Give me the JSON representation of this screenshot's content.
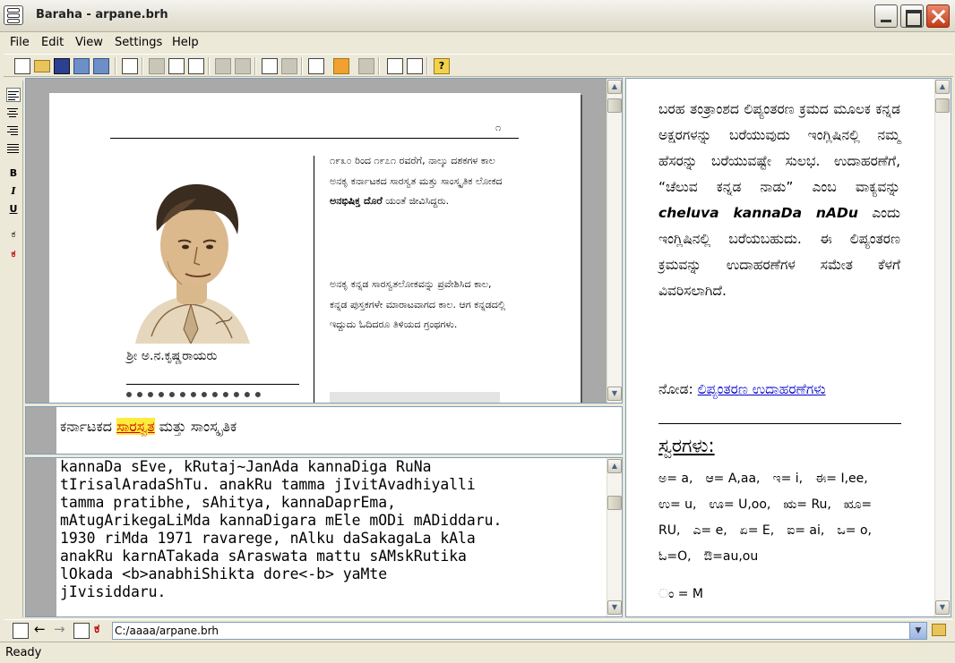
{
  "window": {
    "title": "Baraha  - arpane.brh"
  },
  "menu": [
    "File",
    "Edit",
    "View",
    "Settings",
    "Help"
  ],
  "format_bar": {
    "bold": "B",
    "italic": "I",
    "underline": "U",
    "lang1": "ಕ",
    "lang2": "ಕ"
  },
  "toolbar": {
    "help": "?"
  },
  "preview": {
    "page_number": "೧",
    "caption": "ಶ್ರೀ ಅ.ನ.ಕೃಷ್ಣರಾಯರು",
    "para1": "೧೯೩೦ ರಿಂದ ೧೯೭೧ ರವರೆಗೆ, ನಾಲ್ಕು ದಶಕಗಳ ಕಾಲ ಅನಕೃ ಕರ್ನಾಟಕದ ಸಾರಸ್ವತ ಮತ್ತು ಸಾಂಸ್ಕೃತಿಕ ಲೋಕದ",
    "para1_bold": "ಅನಭಿಷಿಕ್ತ ದೊರೆ",
    "para1_end": "ಯಂತೆ ಜೀವಿಸಿದ್ದರು.",
    "para2": "ಅನಕೃ ಕನ್ನಡ ಸಾರಸ್ವತಲೋಕವನ್ನು ಪ್ರವೇಶಿಸಿದ ಕಾಲ, ಕನ್ನಡ ಪುಸ್ತಕಗಳೇ ಮಾರಾಟವಾಗದ ಕಾಲ. ಆಗ ಕನ್ನಡದಲ್ಲಿ ಇದ್ದುದು ಓದಿದರೂ ತಿಳಿಯದ ಗ್ರಂಥಗಳು."
  },
  "kannada_line": {
    "before": "ಕರ್ನಾಟಕದ",
    "highlight": "ಸಾರಸ್ವತ",
    "after": "ಮತ್ತು ಸಾಂಸ್ಕೃತಿಕ"
  },
  "editor": {
    "lines": [
      "kannaDa sEve, kRutaj~JanAda kannaDiga RuNa",
      "tIrisalAradaShTu. anakRu tamma jIvitAvadhiyalli",
      "tamma pratibhe, sAhitya, kannaDaprEma,",
      "mAtugArikegaLiMda kannaDigara mEle mODi mADiddaru.",
      "1930 riMda 1971 ravarege, nAlku daSakagaLa kAla",
      "anakRu karnATakada sAraswata mattu sAMskRutika",
      "lOkada <b>anabhiShikta dore<-b> yaMte",
      "jIvisiddaru."
    ]
  },
  "help_pane": {
    "para1": "ಬರಹ ತಂತ್ರಾಂಶದ ಲಿಪ್ಯಂತರಣ ಕ್ರಮದ ಮೂಲಕ ಕನ್ನಡ ಅಕ್ಷರಗಳನ್ನು ಬರೆಯುವುದು ಇಂಗ್ಲಿಷಿನಲ್ಲಿ ನಮ್ಮ ಹೆಸರನ್ನು ಬರೆಯುವಷ್ಟೇ ಸುಲಭ. ಉದಾಹರಣೆಗೆ, “ಚೆಲುವ ಕನ್ನಡ ನಾಡು” ಎಂಬ ವಾಕ್ಯವನ್ನು",
    "example": "cheluva kannaDa nADu",
    "para1_end": "ಎಂದು ಇಂಗ್ಲಿಷಿನಲ್ಲಿ ಬರೆಯಬಹುದು. ಈ ಲಿಪ್ಯಂತರಣ ಕ್ರಮವನ್ನು ಉದಾಹರಣೆಗಳ ಸಮೇತ ಕೆಳಗೆ ವಿವರಿಸಲಾಗಿದೆ.",
    "see_label": "ನೋಡ:",
    "see_link": "ಲಿಪ್ಯಂತರಣ ಉದಾಹರಣೆಗಳು",
    "heading": "ಸ್ವರಗಳು:",
    "vowels": [
      "ಅ= a,",
      "ಆ= A,aa,",
      "ಇ= i,",
      "ಈ= I,ee,",
      "ಉ= u,",
      "ಊ= U,oo,",
      "ಋ= Ru,",
      "ೠ=",
      "RU,",
      "ಎ= e,",
      "ಏ= E,",
      "ಐ= ai,",
      "ಒ= o,",
      "ಓ=O,",
      "ಔ=au,ou"
    ],
    "extra": "ಂ = M"
  },
  "bottom_bar": {
    "path": "C:/aaaa/arpane.brh"
  },
  "status": "Ready"
}
